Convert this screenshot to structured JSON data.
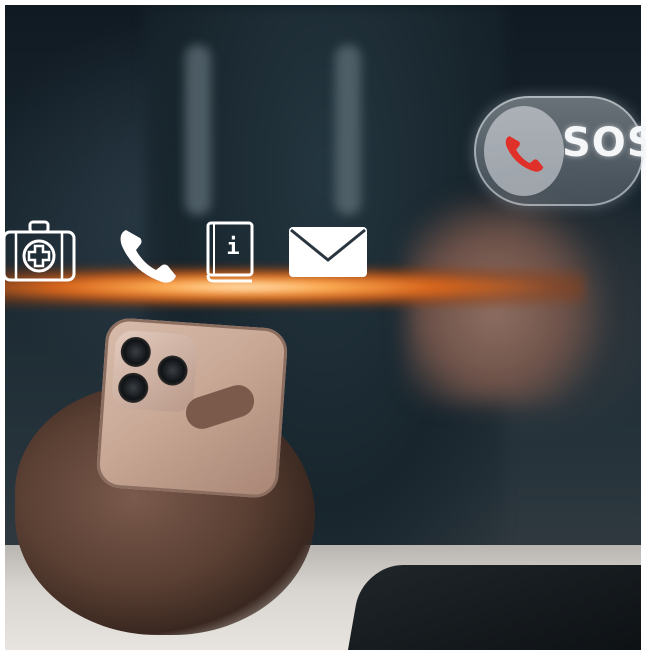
{
  "image": {
    "scene": "hand-holding-phone-with-floating-sos-icons"
  },
  "sos_button": {
    "label": "SOS",
    "icon": "phone-icon",
    "icon_color": "#e0302a"
  },
  "floating_icons": [
    {
      "name": "first-aid-kit-icon"
    },
    {
      "name": "phone-icon"
    },
    {
      "name": "info-book-icon",
      "glyph": "i"
    },
    {
      "name": "envelope-icon"
    }
  ],
  "colors": {
    "glow": "#ffb35a",
    "icon_stroke": "#ffffff"
  }
}
